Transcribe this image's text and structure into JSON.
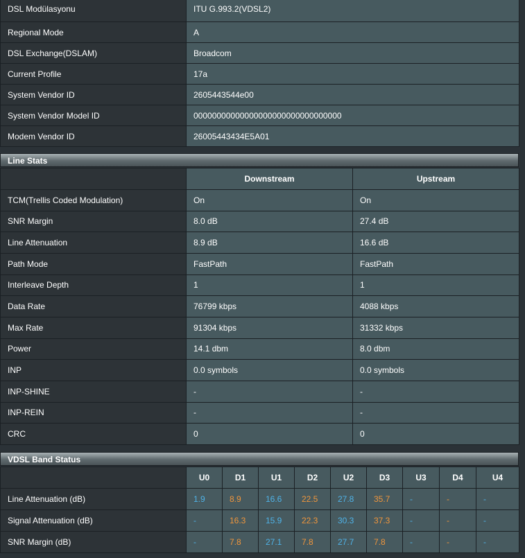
{
  "info_rows": [
    {
      "label": "DSL Modülasyonu",
      "value": "ITU G.993.2(VDSL2)"
    },
    {
      "label": "Regional Mode",
      "value": "A"
    },
    {
      "label": "DSL Exchange(DSLAM)",
      "value": "Broadcom"
    },
    {
      "label": "Current Profile",
      "value": "17a"
    },
    {
      "label": "System Vendor ID",
      "value": "2605443544e00"
    },
    {
      "label": "System Vendor Model ID",
      "value": "00000000000000000000000000000000"
    },
    {
      "label": "Modem Vendor ID",
      "value": "26005443434E5A01"
    }
  ],
  "line_stats": {
    "title": "Line Stats",
    "col_downstream": "Downstream",
    "col_upstream": "Upstream",
    "rows": [
      {
        "label": "TCM(Trellis Coded Modulation)",
        "down": "On",
        "up": "On"
      },
      {
        "label": "SNR Margin",
        "down": "8.0 dB",
        "up": "27.4 dB"
      },
      {
        "label": "Line Attenuation",
        "down": "8.9 dB",
        "up": "16.6 dB"
      },
      {
        "label": "Path Mode",
        "down": "FastPath",
        "up": "FastPath"
      },
      {
        "label": "Interleave Depth",
        "down": "1",
        "up": "1"
      },
      {
        "label": "Data Rate",
        "down": "76799 kbps",
        "up": "4088 kbps"
      },
      {
        "label": "Max Rate",
        "down": "91304 kbps",
        "up": "31332 kbps"
      },
      {
        "label": "Power",
        "down": "14.1 dbm",
        "up": "8.0 dbm"
      },
      {
        "label": "INP",
        "down": "0.0 symbols",
        "up": "0.0 symbols"
      },
      {
        "label": "INP-SHINE",
        "down": "-",
        "up": "-"
      },
      {
        "label": "INP-REIN",
        "down": "-",
        "up": "-"
      },
      {
        "label": "CRC",
        "down": "0",
        "up": "0"
      }
    ]
  },
  "vdsl_band": {
    "title": "VDSL Band Status",
    "bands": [
      "U0",
      "D1",
      "U1",
      "D2",
      "U2",
      "D3",
      "U3",
      "D4",
      "U4"
    ],
    "upstream_color": "#4fb3e8",
    "downstream_color": "#f0963c",
    "rows": [
      {
        "label": "Line Attenuation (dB)",
        "values": [
          "1.9",
          "8.9",
          "16.6",
          "22.5",
          "27.8",
          "35.7",
          "-",
          "-",
          "-"
        ]
      },
      {
        "label": "Signal Attenuation (dB)",
        "values": [
          "-",
          "16.3",
          "15.9",
          "22.3",
          "30.3",
          "37.3",
          "-",
          "-",
          "-"
        ]
      },
      {
        "label": "SNR Margin (dB)",
        "values": [
          "-",
          "7.8",
          "27.1",
          "7.8",
          "27.7",
          "7.8",
          "-",
          "-",
          "-"
        ]
      }
    ]
  }
}
